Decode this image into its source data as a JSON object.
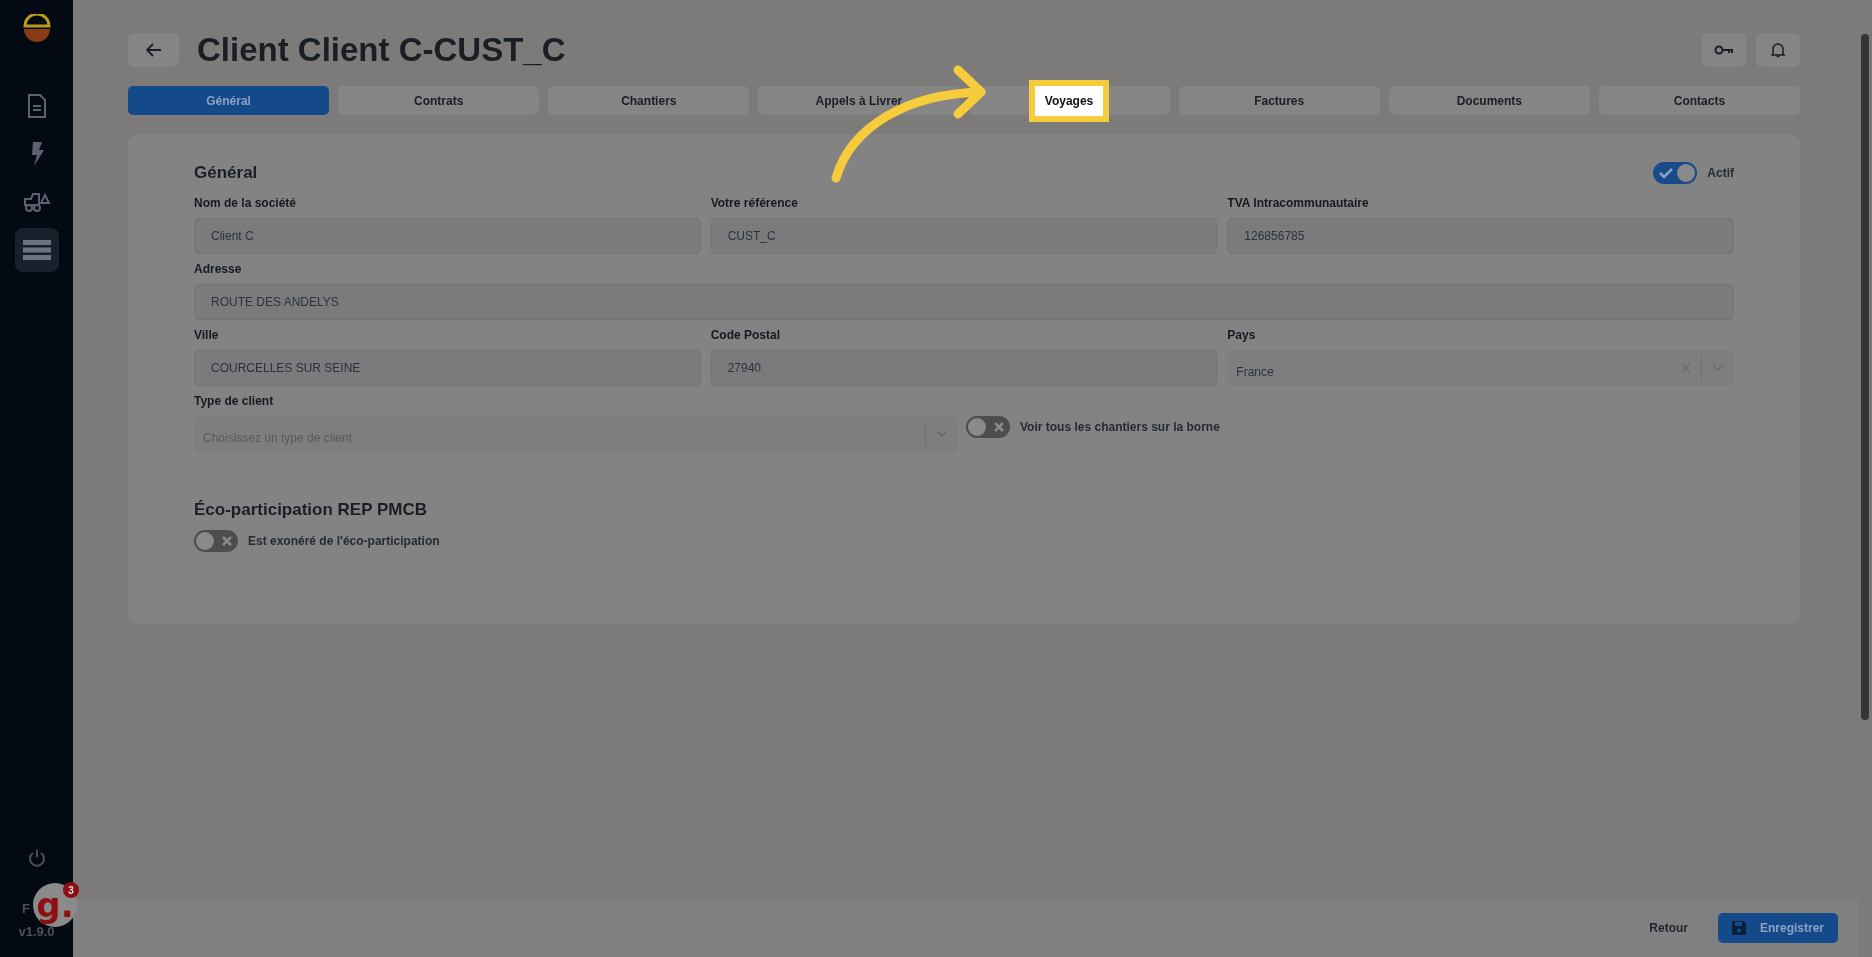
{
  "sidebar": {
    "items": [
      {
        "kind": "document",
        "selected": false
      },
      {
        "kind": "bolt",
        "selected": false
      },
      {
        "kind": "truck",
        "selected": false
      },
      {
        "kind": "list",
        "selected": true
      }
    ],
    "language": "F",
    "version": "v1.9.0"
  },
  "help_widget": {
    "logo": "g.",
    "badge": "3"
  },
  "header": {
    "title": "Client Client C-CUST_C"
  },
  "tabs": [
    {
      "label": "Général",
      "selected": true,
      "highlighted": false
    },
    {
      "label": "Contrats",
      "selected": false,
      "highlighted": false
    },
    {
      "label": "Chantiers",
      "selected": false,
      "highlighted": false
    },
    {
      "label": "Appels à Livrer",
      "selected": false,
      "highlighted": false
    },
    {
      "label": "Voyages",
      "selected": false,
      "highlighted": true
    },
    {
      "label": "Factures",
      "selected": false,
      "highlighted": false
    },
    {
      "label": "Documents",
      "selected": false,
      "highlighted": false
    },
    {
      "label": "Contacts",
      "selected": false,
      "highlighted": false
    }
  ],
  "general": {
    "title": "Général",
    "active_toggle": {
      "label": "Actif",
      "on": true
    },
    "rows": [
      [
        {
          "label": "Nom de la société",
          "value": "Client C",
          "kind": "text"
        },
        {
          "label": "Votre référence",
          "value": "CUST_C",
          "kind": "text"
        },
        {
          "label": "TVA Intracommunautaire",
          "value": "126856785",
          "kind": "text"
        }
      ],
      [
        {
          "label": "Adresse",
          "value": "ROUTE DES ANDELYS",
          "kind": "text"
        }
      ],
      [
        {
          "label": "Ville",
          "value": "COURCELLES SUR SEINE",
          "kind": "text"
        },
        {
          "label": "Code Postal",
          "value": "27940",
          "kind": "text"
        },
        {
          "label": "Pays",
          "value": "France",
          "kind": "select"
        }
      ]
    ],
    "client_type": {
      "label": "Type de client",
      "placeholder": "Choisissez un type de client"
    },
    "site_toggle": {
      "label": "Voir tous les chantiers sur la borne",
      "on": false
    }
  },
  "eco": {
    "title": "Éco-participation REP PMCB",
    "toggle": {
      "label": "Est exonéré de l'éco-participation",
      "on": false
    }
  },
  "footer": {
    "back": "Retour",
    "save": "Enregistrer"
  }
}
